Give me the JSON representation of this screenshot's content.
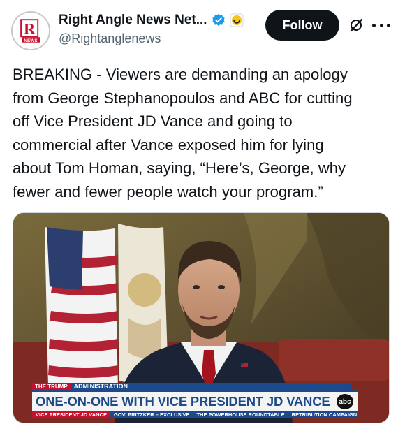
{
  "author": {
    "display_name": "Right Angle News Net...",
    "handle": "@Rightanglenews",
    "avatar_text": "R",
    "avatar_subtext": "NEWS",
    "verified_icon": "verified-badge-icon",
    "affiliate_icon": "affiliate-badge-icon"
  },
  "actions": {
    "follow_label": "Follow",
    "grok_icon": "grok-icon",
    "more_icon": "more-icon"
  },
  "tweet": {
    "text": "BREAKING - Viewers are demanding an apology\nfrom George Stephanopoulos and ABC for cutting\noff Vice President JD Vance and going to\ncommercial after Vance exposed him for lying\nabout Tom Homan, saying, “Here’s, George, why\nfewer and fewer people watch your program.”"
  },
  "media": {
    "lower_third": {
      "tag_small": "THE TRUMP",
      "tag_label": "ADMINISTRATION",
      "headline": "ONE-ON-ONE WITH VICE PRESIDENT JD VANCE",
      "network_logo": "abc",
      "ticker": [
        "VICE PRESIDENT JD VANCE",
        "GOV. PRITZKER – EXCLUSIVE",
        "THE POWERHOUSE ROUNDTABLE",
        "RETRIBUTION CAMPAIGN"
      ]
    }
  },
  "colors": {
    "follow_bg": "#0f1419",
    "verified_blue": "#1d9bf0",
    "abc_blue": "#1d4a8a",
    "abc_red": "#c8102e"
  }
}
